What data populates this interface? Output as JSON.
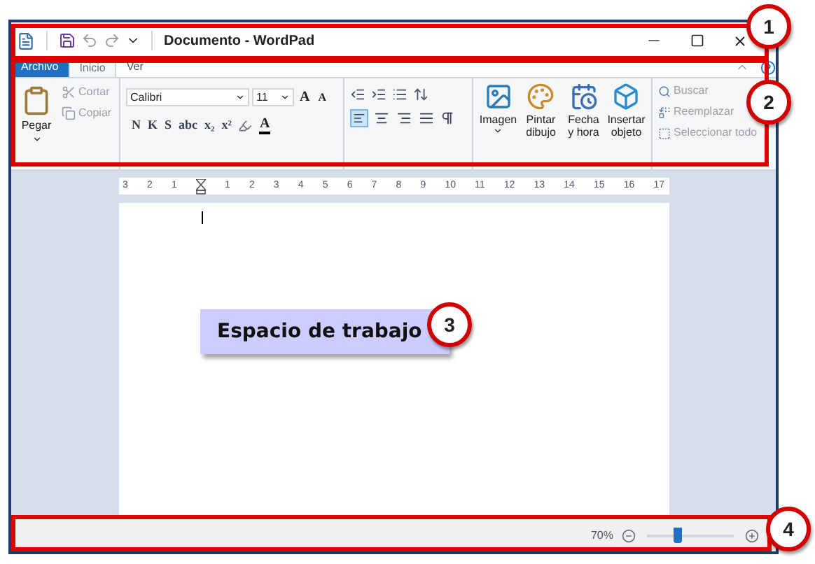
{
  "window": {
    "title": "Documento - WordPad"
  },
  "tabs": [
    {
      "label": "Archivo",
      "kind": "file",
      "selected": false
    },
    {
      "label": "Inicio",
      "kind": "tab",
      "selected": true
    },
    {
      "label": "Ver",
      "kind": "tab",
      "selected": false
    }
  ],
  "clipboard": {
    "paste": "Pegar",
    "cut": "Cortar",
    "copy": "Copiar"
  },
  "font": {
    "family": "Calibri",
    "size": "11",
    "grow": "A",
    "shrink": "A",
    "styles": [
      "N",
      "K",
      "S",
      "abc",
      "x₂",
      "x²"
    ],
    "color_label": "A"
  },
  "paragraph": {
    "alignments": [
      {
        "kind": "left",
        "selected": true
      },
      {
        "kind": "center",
        "selected": false
      },
      {
        "kind": "right",
        "selected": false
      },
      {
        "kind": "justify",
        "selected": false
      }
    ]
  },
  "insert": {
    "items": [
      {
        "label": "Imagen",
        "kind": "image"
      },
      {
        "label": "Pintar dibujo",
        "kind": "paint"
      },
      {
        "label": "Fecha y hora",
        "kind": "calendar"
      },
      {
        "label": "Insertar objeto",
        "kind": "object"
      }
    ]
  },
  "editing": {
    "items": [
      {
        "label": "Buscar",
        "kind": "find"
      },
      {
        "label": "Reemplazar",
        "kind": "replace"
      },
      {
        "label": "Seleccionar todo",
        "kind": "select_all"
      }
    ]
  },
  "ruler": {
    "labels": [
      "3",
      "2",
      "1",
      "1",
      "2",
      "3",
      "4",
      "5",
      "6",
      "7",
      "8",
      "9",
      "10",
      "11",
      "12",
      "13",
      "14",
      "15",
      "16",
      "17"
    ]
  },
  "status_bar": {
    "zoom": "70%",
    "level": 0.35
  },
  "annotations": [
    {
      "number": "1"
    },
    {
      "number": "2"
    },
    {
      "number": "3"
    },
    {
      "number": "4"
    }
  ],
  "callout": {
    "label": "Espacio de trabajo"
  }
}
